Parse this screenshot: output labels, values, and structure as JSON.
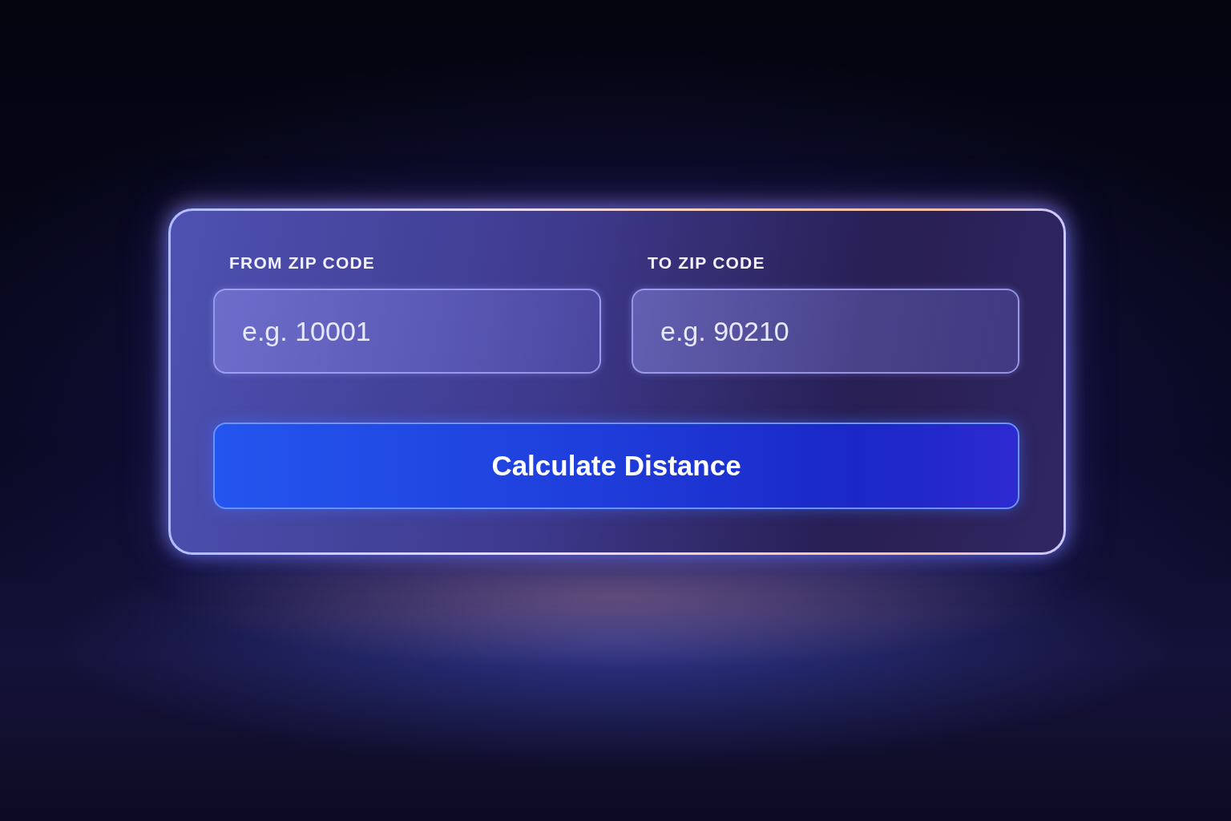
{
  "form": {
    "fields": [
      {
        "label": "FROM ZIP CODE",
        "placeholder": "e.g. 10001"
      },
      {
        "label": "TO ZIP CODE",
        "placeholder": "e.g. 90210"
      }
    ],
    "button": {
      "label": "Calculate Distance"
    }
  }
}
